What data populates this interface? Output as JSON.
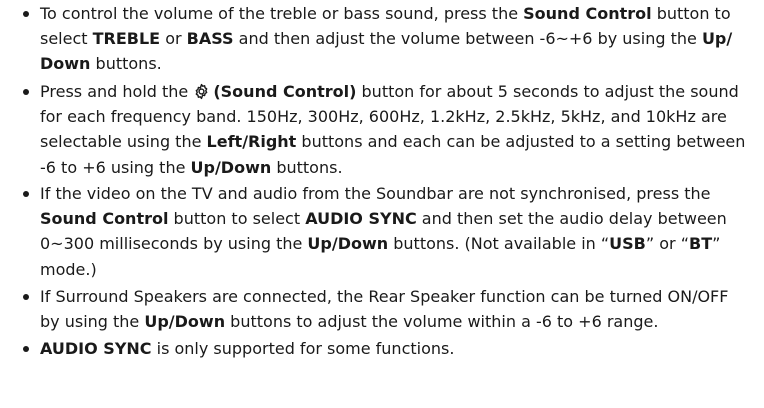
{
  "items": [
    {
      "lines": [
        [
          "To control the volume of the treble or bass sound, press the ",
          {
            "b": "Sound Control"
          },
          " button to"
        ],
        [
          "select ",
          {
            "b": "TREBLE"
          },
          " or ",
          {
            "b": "BASS"
          },
          " and then adjust the volume between -6~+6 by using the ",
          {
            "b": "Up/"
          }
        ],
        [
          {
            "b": "Down"
          },
          " buttons."
        ]
      ]
    },
    {
      "lines": [
        [
          "Press and hold the ",
          {
            "icon": "gear-icon"
          },
          {
            "b": "(Sound Control)"
          },
          " button for about 5 seconds to adjust the sound"
        ],
        [
          "for each frequency band. 150Hz, 300Hz, 600Hz, 1.2kHz, 2.5kHz, 5kHz, and 10kHz are"
        ],
        [
          "selectable using the ",
          {
            "b": "Left/Right"
          },
          " buttons and each can be adjusted to a setting between"
        ],
        [
          "-6 to +6 using the ",
          {
            "b": "Up/Down"
          },
          " buttons."
        ]
      ]
    },
    {
      "lines": [
        [
          "If the video on the TV and audio from the Soundbar are not synchronised, press the"
        ],
        [
          {
            "b": "Sound Control"
          },
          " button to select ",
          {
            "b": "AUDIO SYNC"
          },
          " and then set the audio delay between"
        ],
        [
          "0~300 milliseconds by using the ",
          {
            "b": "Up/Down"
          },
          " buttons. (Not available in “",
          {
            "b": "USB"
          },
          "” or “",
          {
            "b": "BT"
          },
          "”"
        ],
        [
          "mode.)"
        ]
      ]
    },
    {
      "lines": [
        [
          "If Surround Speakers are connected, the Rear Speaker function can be turned ON/OFF"
        ],
        [
          "by using the ",
          {
            "b": "Up/Down"
          },
          " buttons to adjust the volume within a -6 to +6 range."
        ]
      ]
    },
    {
      "lines": [
        [
          {
            "b": "AUDIO SYNC"
          },
          " is only supported for some functions."
        ]
      ]
    }
  ]
}
